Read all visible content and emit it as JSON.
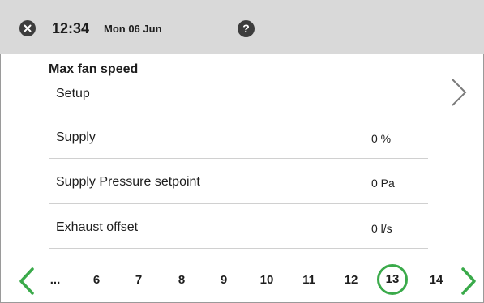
{
  "header": {
    "time": "12:34",
    "date": "Mon 06 Jun",
    "close_icon": "close-icon",
    "help_label": "?"
  },
  "section": {
    "title": "Max fan speed"
  },
  "rows": [
    {
      "label": "Setup",
      "value": ""
    },
    {
      "label": "Supply",
      "value": "0 %"
    },
    {
      "label": "Supply Pressure setpoint",
      "value": "0 Pa"
    },
    {
      "label": "Exhaust offset",
      "value": "0 l/s"
    }
  ],
  "pager": {
    "ellipsis": "...",
    "pages": [
      "6",
      "7",
      "8",
      "9",
      "10",
      "11",
      "12",
      "13",
      "14"
    ],
    "active": "13"
  },
  "colors": {
    "header_bg": "#d9d9d9",
    "accent_green": "#3aaa4a",
    "icon_dark": "#3d3d3d"
  }
}
